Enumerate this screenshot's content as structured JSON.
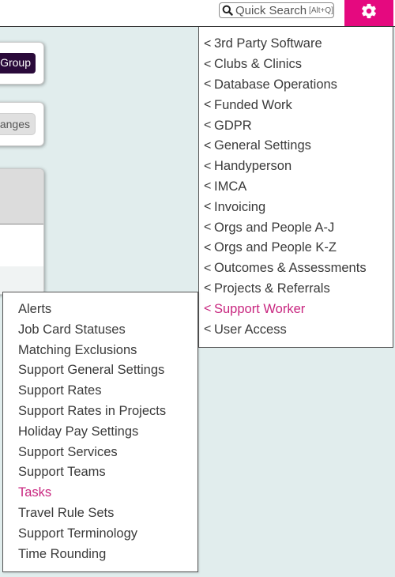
{
  "header": {
    "quick_search": {
      "label": "Quick Search",
      "shortcut": "[Alt+Q]",
      "icon": "search-icon"
    },
    "settings_button": {
      "icon": "gear-icon",
      "color": "#e5097f"
    }
  },
  "background_cards": {
    "group_button_label": "Group",
    "changes_button_label": "Changes"
  },
  "main_menu": {
    "chevron": "<",
    "active_color": "#c8267f",
    "items": [
      {
        "label": "3rd Party Software",
        "active": false
      },
      {
        "label": "Clubs & Clinics",
        "active": false
      },
      {
        "label": "Database Operations",
        "active": false
      },
      {
        "label": "Funded Work",
        "active": false
      },
      {
        "label": "GDPR",
        "active": false
      },
      {
        "label": "General Settings",
        "active": false
      },
      {
        "label": "Handyperson",
        "active": false
      },
      {
        "label": "IMCA",
        "active": false
      },
      {
        "label": "Invoicing",
        "active": false
      },
      {
        "label": "Orgs and People A-J",
        "active": false
      },
      {
        "label": "Orgs and People K-Z",
        "active": false
      },
      {
        "label": "Outcomes & Assessments",
        "active": false
      },
      {
        "label": "Projects & Referrals",
        "active": false
      },
      {
        "label": "Support Worker",
        "active": true
      },
      {
        "label": "User Access",
        "active": false
      }
    ]
  },
  "sub_menu": {
    "parent": "Support Worker",
    "items": [
      {
        "label": "Alerts",
        "active": false
      },
      {
        "label": "Job Card Statuses",
        "active": false
      },
      {
        "label": "Matching Exclusions",
        "active": false
      },
      {
        "label": "Support General Settings",
        "active": false
      },
      {
        "label": "Support Rates",
        "active": false
      },
      {
        "label": "Support Rates in Projects",
        "active": false
      },
      {
        "label": "Holiday Pay Settings",
        "active": false
      },
      {
        "label": "Support Services",
        "active": false
      },
      {
        "label": "Support Teams",
        "active": false
      },
      {
        "label": "Tasks",
        "active": true
      },
      {
        "label": "Travel Rule Sets",
        "active": false
      },
      {
        "label": "Support Terminology",
        "active": false
      },
      {
        "label": "Time Rounding",
        "active": false
      }
    ]
  }
}
